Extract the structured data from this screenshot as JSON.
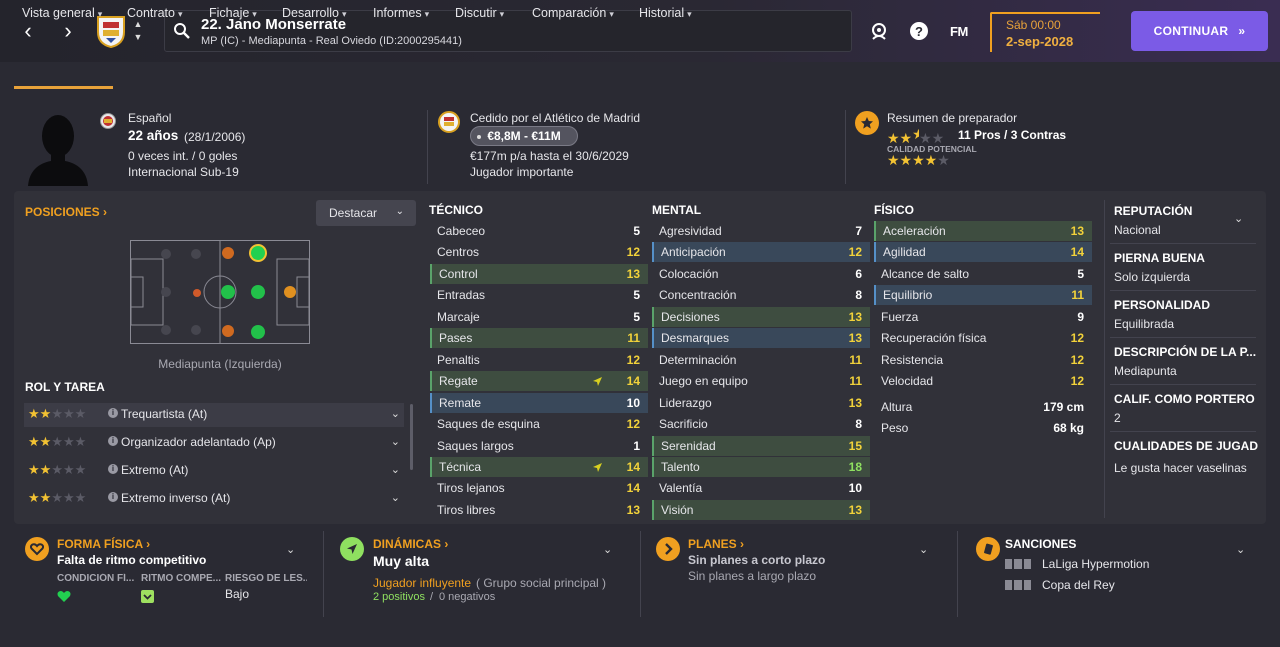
{
  "header": {
    "player_name": "22. Jano Monserrate",
    "player_sub": "MP (IC) - Mediapunta - Real Oviedo (ID:2000295441)",
    "fm_label": "FM",
    "day_time": "Sáb 00:00",
    "date": "2-sep-2028",
    "continue_label": "CONTINUAR"
  },
  "menu": {
    "items": [
      {
        "label": "Vista general"
      },
      {
        "label": "Contrato"
      },
      {
        "label": "Fichaje"
      },
      {
        "label": "Desarrollo"
      },
      {
        "label": "Informes"
      },
      {
        "label": "Discutir"
      },
      {
        "label": "Comparación"
      },
      {
        "label": "Historial"
      }
    ]
  },
  "profile": {
    "nationality": "Español",
    "age": "22 años",
    "birth": "(28/1/2006)",
    "caps": "0 veces int. / 0 goles",
    "intl_level": "Internacional Sub-19"
  },
  "loan": {
    "title": "Cedido por el Atlético de Madrid",
    "value_range": "€8,8M - €11M",
    "wage": "€177m p/a hasta el 30/6/2029",
    "status": "Jugador importante"
  },
  "coach": {
    "title": "Resumen de preparador",
    "pros_cons": "11 Pros / 3 Contras",
    "potential_label": "CALIDAD POTENCIAL",
    "current_stars": 2.5,
    "potential_stars": 4
  },
  "positions": {
    "link": "POSICIONES",
    "highlight_label": "Destacar",
    "selected_position": "Mediapunta (Izquierda)"
  },
  "roles": {
    "header": "ROL Y TAREA",
    "items": [
      {
        "name": "Trequartista (At)",
        "stars": 2
      },
      {
        "name": "Organizador adelantado (Ap)",
        "stars": 2
      },
      {
        "name": "Extremo (At)",
        "stars": 2
      },
      {
        "name": "Extremo inverso (At)",
        "stars": 2
      }
    ]
  },
  "attributes": {
    "tecnico_title": "TÉCNICO",
    "mental_title": "MENTAL",
    "fisico_title": "FÍSICO",
    "tecnico": [
      {
        "name": "Cabeceo",
        "value": "5"
      },
      {
        "name": "Centros",
        "value": "12"
      },
      {
        "name": "Control",
        "value": "13"
      },
      {
        "name": "Entradas",
        "value": "5"
      },
      {
        "name": "Marcaje",
        "value": "5"
      },
      {
        "name": "Pases",
        "value": "11"
      },
      {
        "name": "Penaltis",
        "value": "12"
      },
      {
        "name": "Regate",
        "value": "14"
      },
      {
        "name": "Remate",
        "value": "10"
      },
      {
        "name": "Saques de esquina",
        "value": "12"
      },
      {
        "name": "Saques largos",
        "value": "1"
      },
      {
        "name": "Técnica",
        "value": "14"
      },
      {
        "name": "Tiros lejanos",
        "value": "14"
      },
      {
        "name": "Tiros libres",
        "value": "13"
      }
    ],
    "mental": [
      {
        "name": "Agresividad",
        "value": "7"
      },
      {
        "name": "Anticipación",
        "value": "12"
      },
      {
        "name": "Colocación",
        "value": "6"
      },
      {
        "name": "Concentración",
        "value": "8"
      },
      {
        "name": "Decisiones",
        "value": "13"
      },
      {
        "name": "Desmarques",
        "value": "13"
      },
      {
        "name": "Determinación",
        "value": "11"
      },
      {
        "name": "Juego en equipo",
        "value": "11"
      },
      {
        "name": "Liderazgo",
        "value": "13"
      },
      {
        "name": "Sacrificio",
        "value": "8"
      },
      {
        "name": "Serenidad",
        "value": "15"
      },
      {
        "name": "Talento",
        "value": "18"
      },
      {
        "name": "Valentía",
        "value": "10"
      },
      {
        "name": "Visión",
        "value": "13"
      }
    ],
    "fisico": [
      {
        "name": "Aceleración",
        "value": "13"
      },
      {
        "name": "Agilidad",
        "value": "14"
      },
      {
        "name": "Alcance de salto",
        "value": "5"
      },
      {
        "name": "Equilibrio",
        "value": "11"
      },
      {
        "name": "Fuerza",
        "value": "9"
      },
      {
        "name": "Recuperación física",
        "value": "12"
      },
      {
        "name": "Resistencia",
        "value": "12"
      },
      {
        "name": "Velocidad",
        "value": "12"
      },
      {
        "name": "Altura",
        "value": "179 cm"
      },
      {
        "name": "Peso",
        "value": "68 kg"
      }
    ]
  },
  "info": {
    "reputation_h": "REPUTACIÓN",
    "reputation_v": "Nacional",
    "foot_h": "PIERNA BUENA",
    "foot_v": "Solo izquierda",
    "personality_h": "PERSONALIDAD",
    "personality_v": "Equilibrada",
    "desc_h": "DESCRIPCIÓN DE LA P...",
    "desc_v": "Mediapunta",
    "gk_h": "CALIF. COMO PORTERO",
    "gk_v": "2",
    "qual_h": "CUALIDADES DE JUGADO",
    "qual_v": "Le gusta hacer vaselinas"
  },
  "bottom": {
    "forma_h": "FORMA FÍSICA",
    "forma_v": "Falta de ritmo competitivo",
    "cond_label": "CONDICIÓN FÍ...",
    "ritmo_label": "RITMO COMPE...",
    "riesgo_label": "RIESGO DE LES...",
    "riesgo_v": "Bajo",
    "din_h": "DINÁMICAS",
    "din_v": "Muy alta",
    "din_role": "Jugador influyente",
    "din_group": "( Grupo social principal )",
    "din_pos": "2 positivos",
    "din_sep": "/",
    "din_neg": "0 negativos",
    "planes_h": "PLANES",
    "planes_short": "Sin planes a corto plazo",
    "planes_long": "Sin planes a largo plazo",
    "sanc_h": "SANCIONES",
    "sanc_1": "LaLiga Hypermotion",
    "sanc_2": "Copa del Rey"
  },
  "colors": {
    "accent": "#f0a020",
    "continue": "#7b5be6",
    "green_value": "#8fe060",
    "yellow_value": "#f2d23a",
    "highlight_green": "#3e4d40",
    "highlight_blue": "#39485a"
  }
}
